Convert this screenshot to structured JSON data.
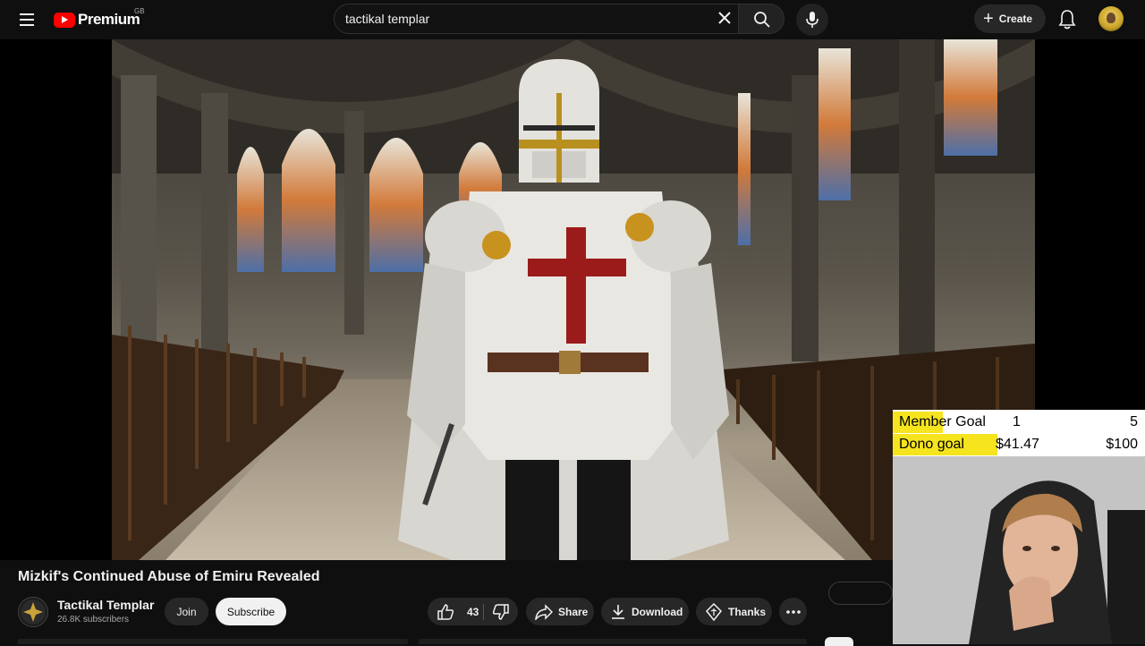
{
  "header": {
    "logo_text": "Premium",
    "country_code": "GB",
    "search": {
      "value": "tactikal templar"
    },
    "create_label": "Create",
    "icons": [
      "menu-icon",
      "youtube-logo",
      "clear-icon",
      "search-icon",
      "mic-icon",
      "plus-icon",
      "bell-icon",
      "avatar"
    ]
  },
  "overlay": {
    "member_goal": {
      "label": "Member Goal",
      "current": "1",
      "target": "5",
      "progress": 0.2
    },
    "dono_goal": {
      "label": "Dono goal",
      "current": "$41.47",
      "target": "$100",
      "progress": 0.4147
    },
    "fill_color": "#f5e41e"
  },
  "video": {
    "title": "Mizkif's Continued Abuse of Emiru Revealed"
  },
  "channel": {
    "name": "Tactikal Templar",
    "subscribers": "26.8K subscribers",
    "join_label": "Join",
    "subscribe_label": "Subscribe"
  },
  "actions": {
    "like_count": "43",
    "share_label": "Share",
    "download_label": "Download",
    "thanks_label": "Thanks"
  },
  "colors": {
    "background": "#0f0f0f",
    "pill": "#272727",
    "brand_red": "#ff0000"
  }
}
